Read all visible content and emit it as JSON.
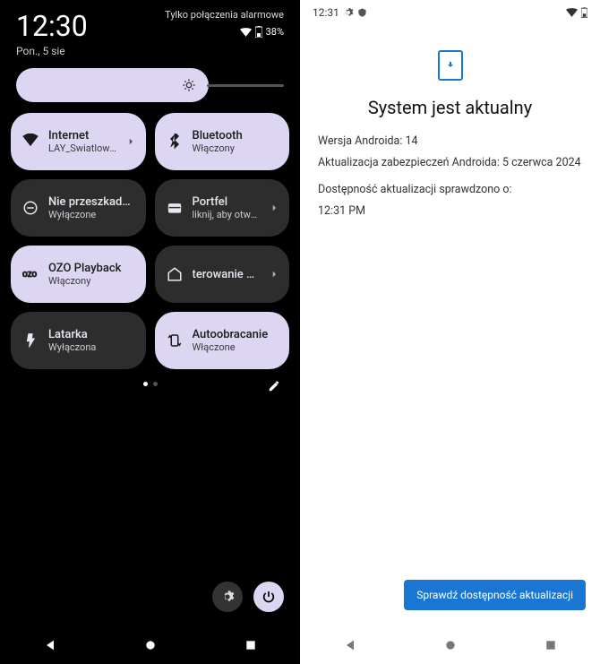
{
  "left": {
    "clock": "12:30",
    "date": "Pon., 5 sie",
    "alarm_only": "Tylko połączenia alarmowe",
    "battery": "38%",
    "tiles": [
      {
        "label": "Internet",
        "sub": "LAY_Swiatlowod",
        "on": true,
        "icon": "wifi",
        "chevron": true
      },
      {
        "label": "Bluetooth",
        "sub": "Włączony",
        "on": true,
        "icon": "bluetooth"
      },
      {
        "label": "Nie przeszkadzać",
        "sub": "Wyłączone",
        "on": false,
        "icon": "dnd"
      },
      {
        "label": "Portfel",
        "sub": "liknij, aby otworz",
        "on": false,
        "icon": "wallet",
        "chevron": true
      },
      {
        "label": "OZO Playback",
        "sub": "Włączony",
        "on": true,
        "icon": "ozo"
      },
      {
        "label": "terowanie urząd",
        "sub": "",
        "on": false,
        "icon": "home",
        "chevron": true,
        "single": true
      },
      {
        "label": "Latarka",
        "sub": "Wyłączona",
        "on": false,
        "icon": "flash"
      },
      {
        "label": "Autoobracanie",
        "sub": "Włączone",
        "on": true,
        "icon": "rotate"
      }
    ]
  },
  "right": {
    "clock": "12:31",
    "title": "System jest aktualny",
    "version_line": "Wersja Androida: 14",
    "security_line": "Aktualizacja zabezpieczeń Androida: 5 czerwca 2024",
    "checked_line": "Dostępność aktualizacji sprawdzono o:",
    "checked_time": "12:31 PM",
    "button": "Sprawdź dostępność aktualizacji"
  }
}
